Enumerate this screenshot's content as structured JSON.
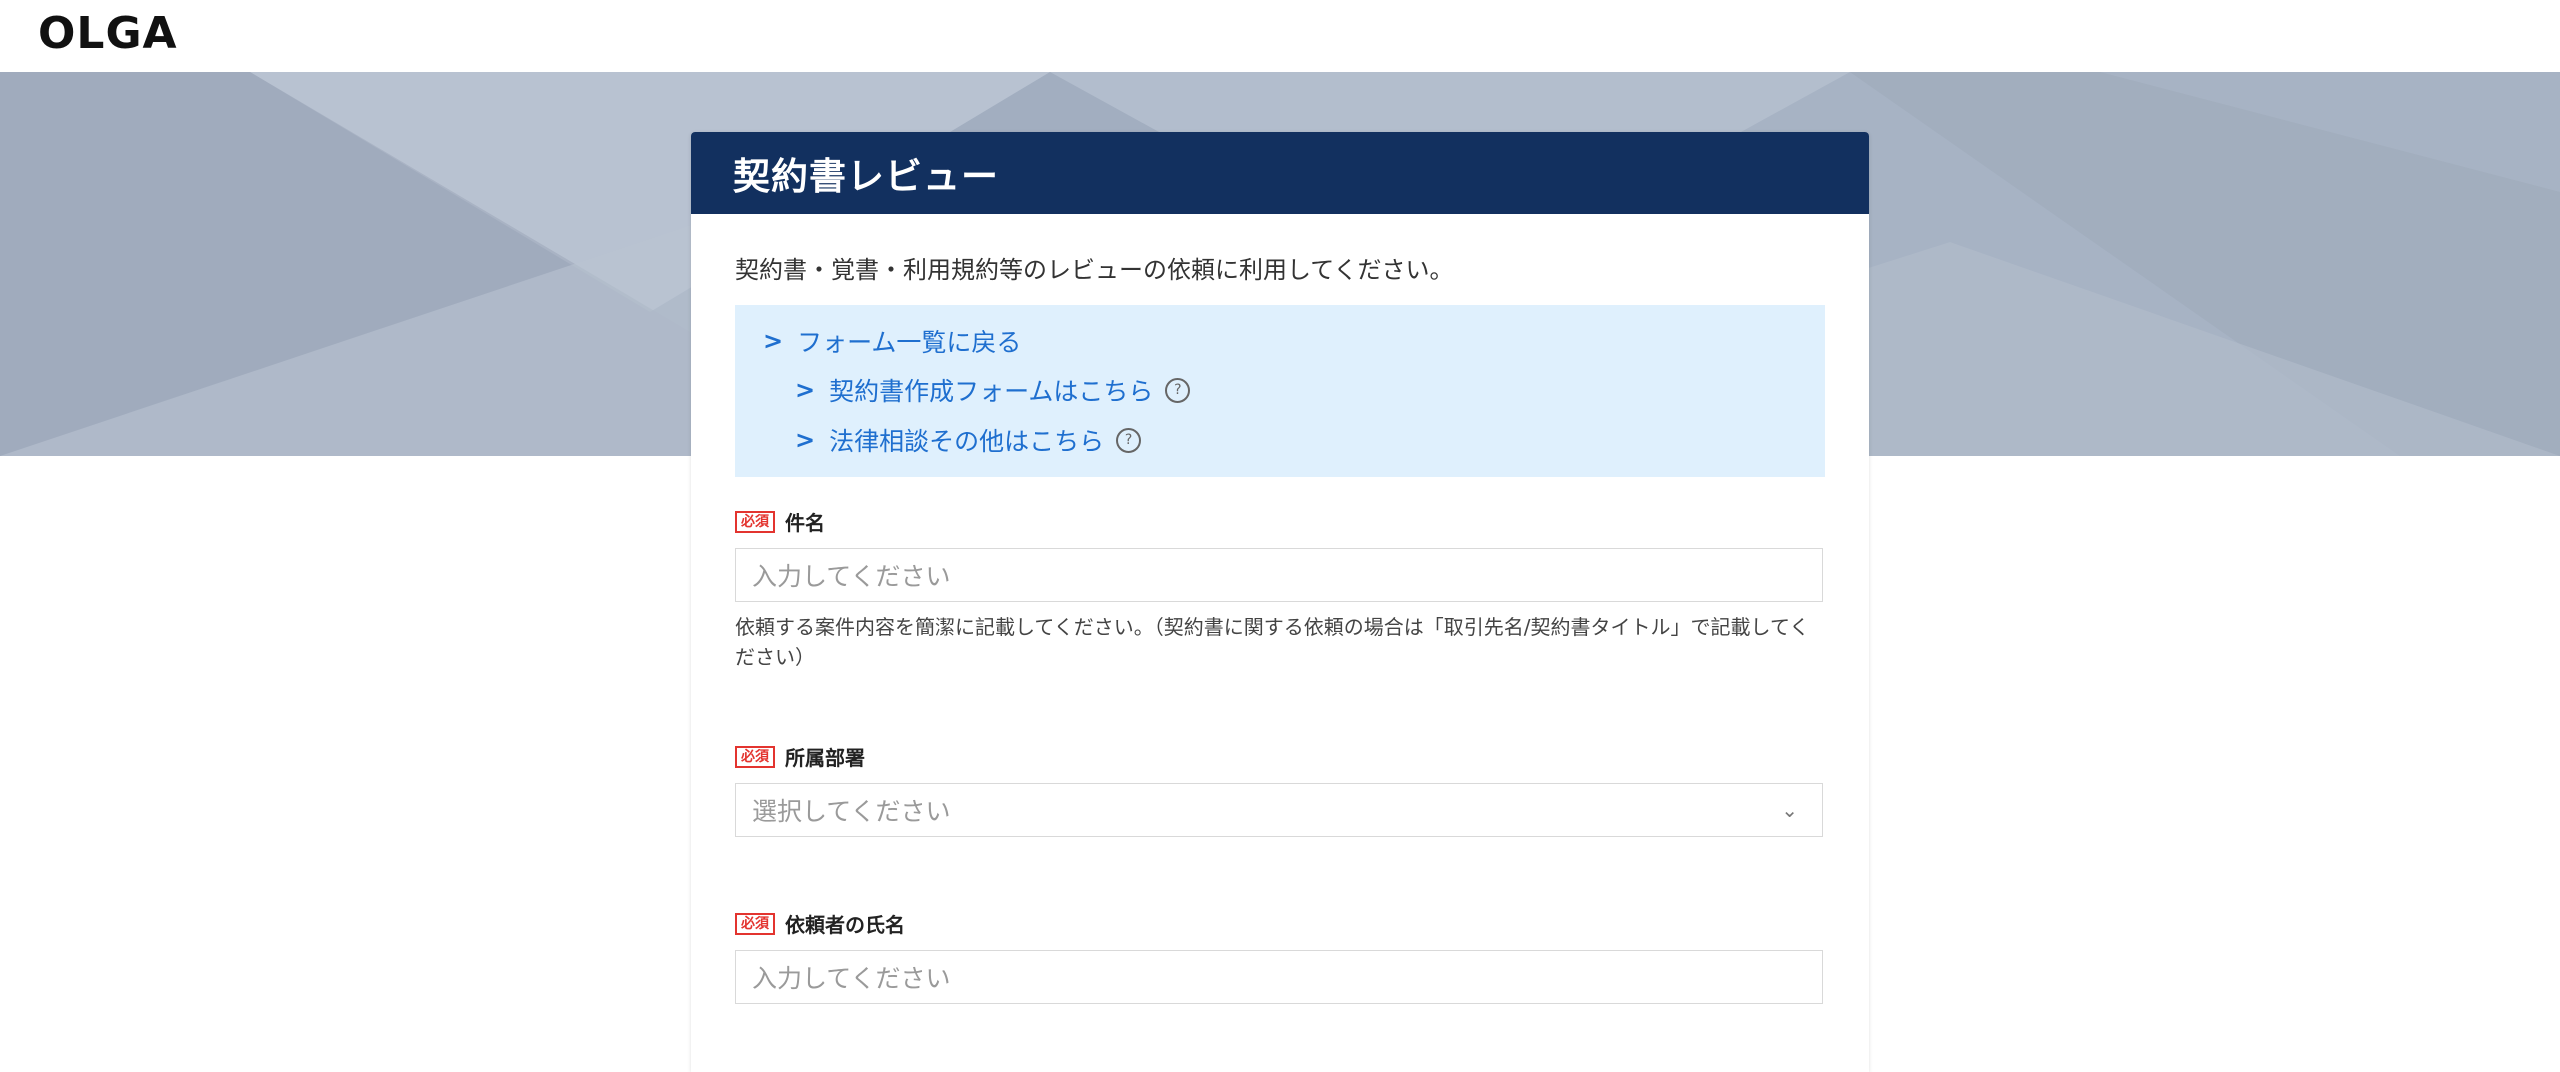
{
  "brand": {
    "logo": "OLGA"
  },
  "form": {
    "title": "契約書レビュー",
    "description": "契約書・覚書・利用規約等のレビューの依頼に利用してください。",
    "links": [
      {
        "label": "フォーム一覧に戻る",
        "help": false
      },
      {
        "label": "契約書作成フォームはこちら",
        "help": true
      },
      {
        "label": "法律相談その他はこちら",
        "help": true
      }
    ],
    "help_icon_glyph": "?",
    "fields": [
      {
        "required_badge": "必須",
        "label": "件名",
        "placeholder": "入力してください",
        "help_text": "依頼する案件内容を簡潔に記載してください。（契約書に関する依頼の場合は「取引先名/契約書タイトル」で記載してください）"
      },
      {
        "required_badge": "必須",
        "label": "所属部署",
        "placeholder": "選択してください",
        "select_icon": "chevron-down-icon"
      },
      {
        "required_badge": "必須",
        "label": "依頼者の氏名",
        "placeholder": "入力してください"
      }
    ]
  },
  "colors": {
    "header_bg": "#12305f",
    "link": "#1f6fcf",
    "links_panel_bg": "#dff0fd",
    "required_badge": "#e3342f",
    "hero_bg": "#a9b6c8"
  }
}
